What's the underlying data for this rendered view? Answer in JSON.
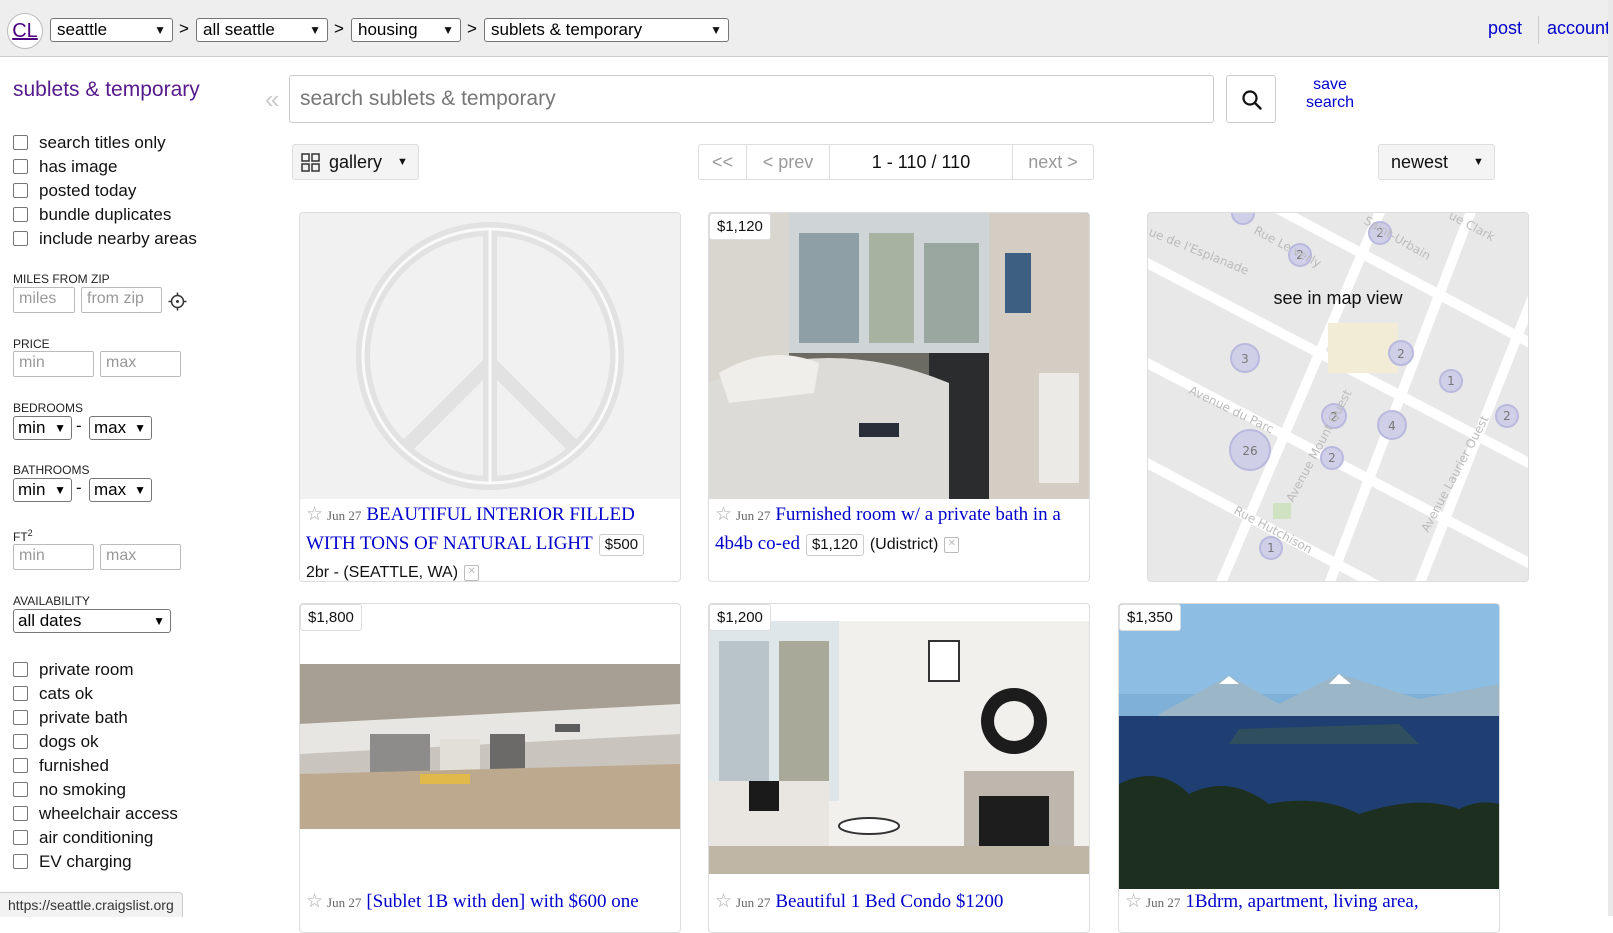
{
  "header": {
    "logo": "CL",
    "city": "seattle",
    "area": "all seattle",
    "category": "housing",
    "subcategory": "sublets & temporary",
    "sep": ">",
    "post": "post",
    "account": "account"
  },
  "sidebar": {
    "title": "sublets & temporary",
    "options": [
      "search titles only",
      "has image",
      "posted today",
      "bundle duplicates",
      "include nearby areas"
    ],
    "miles_label": "MILES FROM ZIP",
    "miles_placeholder": "miles",
    "zip_placeholder": "from zip",
    "price_label": "PRICE",
    "min_placeholder": "min",
    "max_placeholder": "max",
    "bedrooms_label": "BEDROOMS",
    "bathrooms_label": "BATHROOMS",
    "sel_min": "min",
    "sel_max": "max",
    "dash": "-",
    "ft_label": "FT",
    "ft_sup": "2",
    "availability_label": "AVAILABILITY",
    "availability_value": "all dates",
    "filters": [
      "private room",
      "cats ok",
      "private bath",
      "dogs ok",
      "furnished",
      "no smoking",
      "wheelchair access",
      "air conditioning",
      "EV charging"
    ]
  },
  "search": {
    "collapse": "«",
    "placeholder": "search sublets & temporary",
    "save_line1": "save",
    "save_line2": "search"
  },
  "toolbar": {
    "view": "gallery",
    "first": "<<",
    "prev": "< prev",
    "range": "1 - 110 / 110",
    "next": "next >",
    "sort": "newest"
  },
  "map": {
    "label": "see in map view"
  },
  "listings": [
    {
      "date": "Jun 27",
      "title": "BEAUTIFUL INTERIOR FILLED WITH TONS OF NATURAL LIGHT",
      "price": "$500",
      "extra": "2br - (SEATTLE, WA)"
    },
    {
      "date": "Jun 27",
      "title": "Furnished room w/ a private bath in a 4b4b co-ed",
      "price": "$1,120",
      "tag": "$1,120",
      "extra": "(Udistrict)"
    },
    {
      "date": "Jun 27",
      "title": "[Sublet 1B with den] with $600 one",
      "tag": "$1,800"
    },
    {
      "date": "Jun 27",
      "title": "Beautiful 1 Bed Condo $1200",
      "tag": "$1,200"
    },
    {
      "date": "Jun 27",
      "title": "1Bdrm, apartment, living area,",
      "tag": "$1,350"
    }
  ],
  "status_url": "https://seattle.craigslist.org",
  "colors": {
    "link": "#0000cc",
    "visited": "#551a8b",
    "header_bg": "#eeeeee"
  }
}
